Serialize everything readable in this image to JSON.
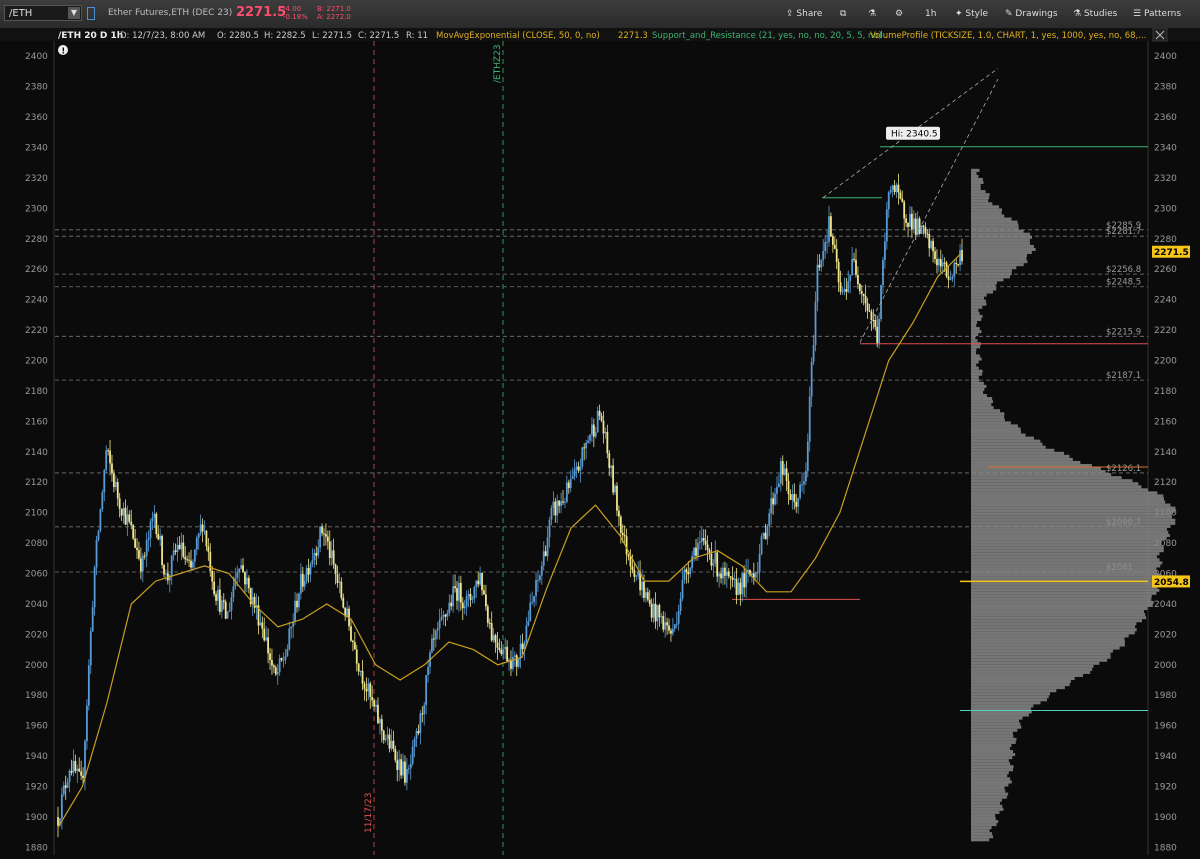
{
  "toolbar": {
    "symbol": "/ETH",
    "description": "Ether Futures,ETH (DEC 23)",
    "last_price": "2271.5",
    "change": "-4.00",
    "change_pct": "-0.18%",
    "bid": "B: 2271.0",
    "ask": "A: 2272.0",
    "buttons": {
      "share": "Share",
      "timeframe": "1h",
      "style": "Style",
      "drawings": "Drawings",
      "studies": "Studies",
      "patterns": "Patterns"
    }
  },
  "header": {
    "symbol_period": "/ETH 20 D 1h",
    "date": "D: 12/7/23, 8:00 AM",
    "open": "O: 2280.5",
    "high": "H: 2282.5",
    "low": "L: 2271.5",
    "close": "C: 2271.5",
    "range": "R: 11",
    "ema_study": "MovAvgExponential (CLOSE, 50, 0, no)",
    "ema_value": "2271.3",
    "sr_study": "Support_and_Resistance (21, yes, no, no, 20, 5, 5, no)",
    "vp_study": "VolumeProfile (TICKSIZE, 1.0, CHART, 1, yes, 1000, yes, no, 68,..."
  },
  "colors": {
    "up": "#5b9bd5",
    "down": "#f0e68c",
    "ema": "#c8a020",
    "support_green": "#3cb371",
    "support_red": "#e05050",
    "poc": "#f5c518",
    "value_area": "#4fd1c5",
    "price_badge": "#f5c518"
  },
  "chart_data": {
    "type": "candlestick",
    "timeframe": "1h",
    "ylim": [
      1875,
      2410
    ],
    "y_ticks": [
      1880,
      1900,
      1920,
      1940,
      1960,
      1980,
      2000,
      2020,
      2040,
      2060,
      2080,
      2100,
      2120,
      2140,
      2160,
      2180,
      2200,
      2220,
      2240,
      2260,
      2280,
      2300,
      2320,
      2340,
      2360,
      2380,
      2400
    ],
    "close_path": [
      1900,
      1935,
      1920,
      2060,
      2140,
      2110,
      2090,
      2065,
      2100,
      2055,
      2080,
      2060,
      2095,
      2050,
      2030,
      2070,
      2045,
      2025,
      1990,
      2010,
      2050,
      2070,
      2090,
      2060,
      2030,
      2000,
      1975,
      1955,
      1940,
      1925,
      1960,
      2010,
      2030,
      2050,
      2040,
      2060,
      2020,
      2010,
      2000,
      2030,
      2060,
      2100,
      2110,
      2125,
      2150,
      2165,
      2120,
      2080,
      2060,
      2040,
      2030,
      2020,
      2060,
      2080,
      2075,
      2060,
      2050,
      2055,
      2065,
      2100,
      2130,
      2105,
      2120,
      2260,
      2290,
      2240,
      2265,
      2240,
      2215,
      2320,
      2300,
      2290,
      2280,
      2265,
      2255,
      2271
    ],
    "ema50_path": [
      1893,
      1920,
      1975,
      2040,
      2055,
      2060,
      2065,
      2060,
      2040,
      2025,
      2030,
      2040,
      2030,
      2000,
      1990,
      2000,
      2015,
      2010,
      2000,
      2005,
      2050,
      2090,
      2105,
      2085,
      2055,
      2055,
      2070,
      2075,
      2065,
      2048,
      2048,
      2070,
      2100,
      2150,
      2200,
      2225,
      2255,
      2271
    ],
    "hi_label": "Hi: 2340.5",
    "date_markers": [
      {
        "label": "11/17/23",
        "color": "#e05050"
      },
      {
        "label": "/ETHZ23",
        "color": "#3cb371"
      }
    ],
    "sr_levels": [
      {
        "value": 2285.9,
        "label": "$2285.9"
      },
      {
        "value": 2281.7,
        "label": "$2281.7"
      },
      {
        "value": 2256.8,
        "label": "$2256.8"
      },
      {
        "value": 2248.5,
        "label": "$2248.5"
      },
      {
        "value": 2215.9,
        "label": "$2215.9"
      },
      {
        "value": 2187.1,
        "label": "$2187.1"
      },
      {
        "value": 2126.1,
        "label": "$2126.1"
      },
      {
        "value": 2090.7,
        "label": "$2090.7"
      },
      {
        "value": 2061,
        "label": "$2061"
      }
    ],
    "volume_profile_lines": {
      "high": 2340.5,
      "value_area_high": 2211,
      "value_area_mid": 2130,
      "poc": 2054.8,
      "value_area_low": 1970
    },
    "short_levels": [
      {
        "value": 2307,
        "kind": "resistance"
      },
      {
        "value": 2043,
        "kind": "support"
      }
    ],
    "axis_badges": [
      {
        "value": 2271.5,
        "label": "2271.5"
      },
      {
        "value": 2054.8,
        "label": "2054.8"
      }
    ]
  }
}
